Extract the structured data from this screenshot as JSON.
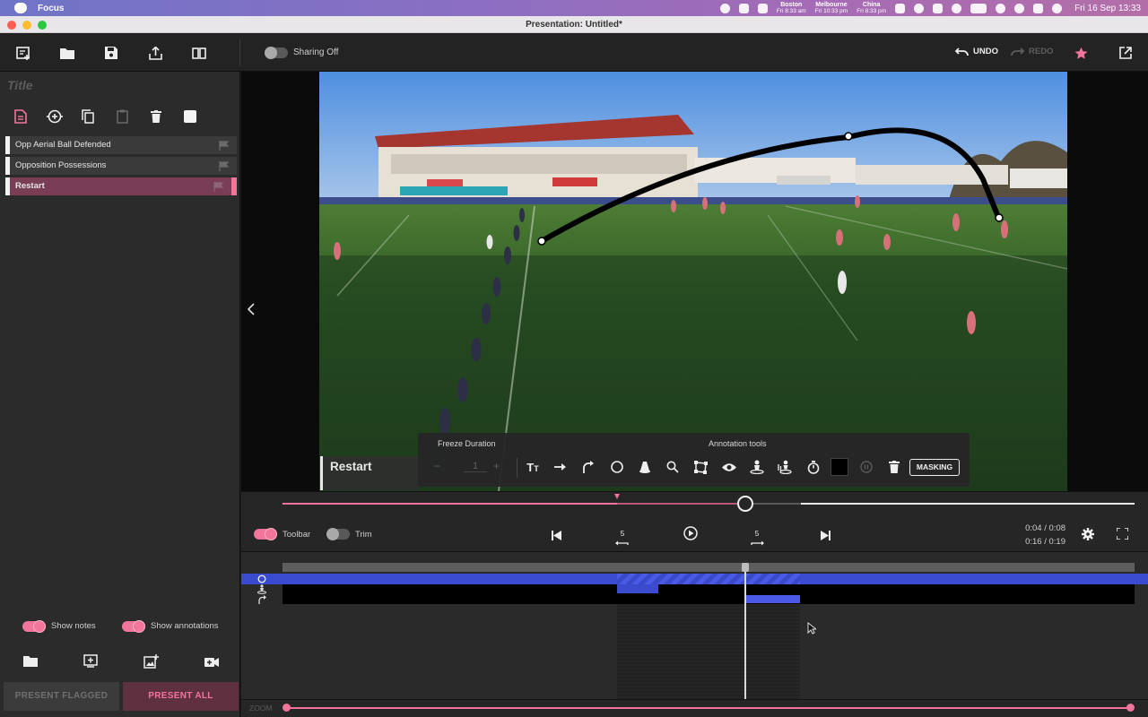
{
  "menubar": {
    "app_name": "Focus",
    "clocks": [
      {
        "city": "Boston",
        "time": "Fri 8:33 am"
      },
      {
        "city": "Melbourne",
        "time": "Fri 10:33 pm"
      },
      {
        "city": "China",
        "time": "Fri 8:33 pm"
      }
    ],
    "datetime": "Fri 16 Sep  13:33"
  },
  "window": {
    "title": "Presentation: Untitled*"
  },
  "toolbar": {
    "sharing_label": "Sharing Off",
    "undo_label": "UNDO",
    "redo_label": "REDO"
  },
  "sidebar": {
    "title_placeholder": "Title",
    "clips": [
      {
        "label": "Opp Aerial Ball Defended",
        "active": false
      },
      {
        "label": "Opposition Possessions",
        "active": false
      },
      {
        "label": "Restart",
        "active": true
      }
    ],
    "show_notes_label": "Show notes",
    "show_annotations_label": "Show annotations",
    "present_flagged_label": "PRESENT FLAGGED",
    "present_all_label": "PRESENT ALL"
  },
  "video": {
    "caption": "Restart"
  },
  "annotation_panel": {
    "freeze_label": "Freeze Duration",
    "freeze_value": "1",
    "tools_label": "Annotation tools",
    "masking_label": "MASKING",
    "tool_icons": [
      "text-icon",
      "arrow-icon",
      "curved-arrow-icon",
      "circle-icon",
      "spotlight-icon",
      "magnify-icon",
      "polygon-icon",
      "eye-icon",
      "player-marker-icon",
      "player-move-icon",
      "timer-icon",
      "color-swatch",
      "pause-icon",
      "trash-icon"
    ]
  },
  "playback": {
    "toolbar_label": "Toolbar",
    "trim_label": "Trim",
    "skip_back_label": "5",
    "skip_fwd_label": "5",
    "clip_time": "0:04 / 0:08",
    "total_time": "0:16 / 0:19",
    "progress_fraction": 0.41
  },
  "zoom_label": "ZOOM",
  "colors": {
    "accent_pink": "#f3759c",
    "clip_active": "#7a3d56",
    "track_blue": "#4252d6"
  }
}
